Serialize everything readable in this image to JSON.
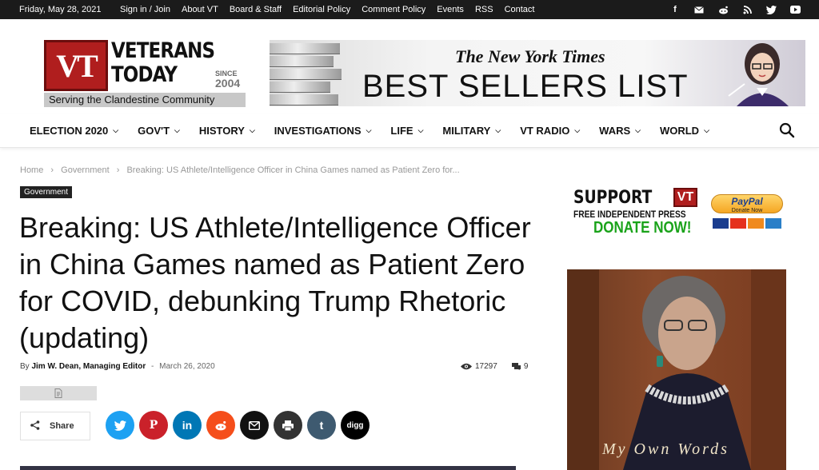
{
  "topbar": {
    "date": "Friday, May 28, 2021",
    "links": [
      "Sign in / Join",
      "About VT",
      "Board & Staff",
      "Editorial Policy",
      "Comment Policy",
      "Events",
      "RSS",
      "Contact"
    ],
    "social_icons": [
      "facebook-icon",
      "email-icon",
      "reddit-icon",
      "rss-icon",
      "twitter-icon",
      "youtube-icon"
    ]
  },
  "logo": {
    "badge": "VT",
    "line1": "VETERANS",
    "line2": "TODAY",
    "since_label": "SINCE",
    "since_year": "2004",
    "tagline": "Serving the Clandestine Community"
  },
  "banner": {
    "publication": "The New York Times",
    "headline": "BEST SELLERS LIST"
  },
  "nav": {
    "items": [
      "ELECTION 2020",
      "GOV'T",
      "HISTORY",
      "INVESTIGATIONS",
      "LIFE",
      "MILITARY",
      "VT RADIO",
      "WARS",
      "WORLD"
    ]
  },
  "breadcrumb": {
    "items": [
      "Home",
      "Government",
      "Breaking: US Athlete/Intelligence Officer in China Games named as Patient Zero for..."
    ],
    "separator": "›"
  },
  "article": {
    "category": "Government",
    "title": "Breaking: US Athlete/Intelligence Officer in China Games named as Patient Zero for COVID, debunking Trump Rhetoric (updating)",
    "by_label": "By",
    "author": "Jim W. Dean, Managing Editor",
    "date_sep": "-",
    "date": "March 26, 2020",
    "views": "17297",
    "comments": "9",
    "share_label": "Share"
  },
  "share_buttons": [
    {
      "name": "twitter",
      "color": "#1da1f2"
    },
    {
      "name": "pinterest",
      "color": "#ca212a"
    },
    {
      "name": "linkedin",
      "color": "#0077b5"
    },
    {
      "name": "reddit",
      "color": "#f54e1b"
    },
    {
      "name": "email",
      "color": "#111111"
    },
    {
      "name": "print",
      "color": "#333333"
    },
    {
      "name": "tumblr",
      "color": "#3e5a70"
    },
    {
      "name": "digg",
      "color": "#000000"
    }
  ],
  "sidebar": {
    "donate": {
      "support": "SUPPORT",
      "badge": "VT",
      "press": "FREE INDEPENDENT PRESS",
      "donate_now": "DONATE NOW!",
      "paypal": "PayPal",
      "paypal_sub": "Donate Now"
    },
    "book": {
      "title_text": "My Own Words"
    }
  }
}
